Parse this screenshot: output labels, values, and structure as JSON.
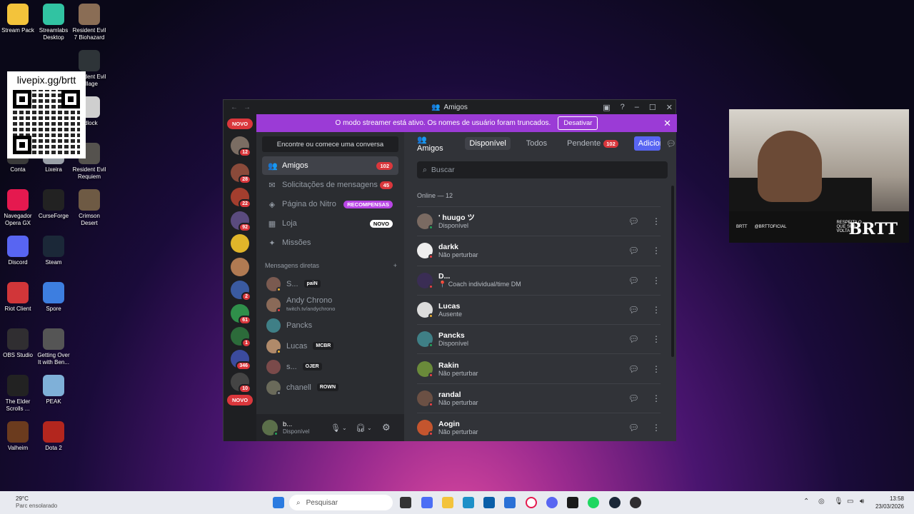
{
  "desktop": {
    "icons": [
      {
        "label": "Stream Pack",
        "glyph": "folder-icon",
        "color": "#f3c33b"
      },
      {
        "label": "Streamlabs Desktop",
        "glyph": "streamlabs-icon",
        "color": "#31c3a2"
      },
      {
        "label": "Resident Evil 7 Biohazard",
        "glyph": "game-icon",
        "color": "#8a6d55"
      },
      {
        "label": "Resident Evil Village",
        "glyph": "game-icon",
        "color": "#2e3438"
      },
      {
        "label": "adlock",
        "glyph": "game-icon",
        "color": "#cfcfcf"
      },
      {
        "label": "Conta",
        "glyph": "user-icon",
        "color": "#3a3a3a"
      },
      {
        "label": "Lixeira",
        "glyph": "trash-icon",
        "color": "#9aa0a8"
      },
      {
        "label": "Resident Evil Requiem",
        "glyph": "game-icon",
        "color": "#55524e"
      },
      {
        "label": "Navegador Opera GX",
        "glyph": "opera-icon",
        "color": "#e5194f"
      },
      {
        "label": "CurseForge",
        "glyph": "curseforge-icon",
        "color": "#222"
      },
      {
        "label": "Crimson Desert",
        "glyph": "game-icon",
        "color": "#6e5a44"
      },
      {
        "label": "Discord",
        "glyph": "discord-icon",
        "color": "#5865f2"
      },
      {
        "label": "Steam",
        "glyph": "steam-icon",
        "color": "#1b2838"
      },
      {
        "label": "Riot Client",
        "glyph": "riot-icon",
        "color": "#d13639"
      },
      {
        "label": "Spore",
        "glyph": "spore-icon",
        "color": "#3d7ee0"
      },
      {
        "label": "OBS Studio",
        "glyph": "obs-icon",
        "color": "#302e31"
      },
      {
        "label": "Getting Over It with Ben...",
        "glyph": "hammer-icon",
        "color": "#555"
      },
      {
        "label": "The Elder Scrolls ...",
        "glyph": "dragon-icon",
        "color": "#222"
      },
      {
        "label": "PEAK",
        "glyph": "mountain-icon",
        "color": "#7fb0d8"
      },
      {
        "label": "Valheim",
        "glyph": "valheim-icon",
        "color": "#6b3b1e"
      },
      {
        "label": "Dota 2",
        "glyph": "dota-icon",
        "color": "#b3261e"
      }
    ],
    "qr_text": "livepix.gg/brtt"
  },
  "window": {
    "title": "Amigos",
    "banner": {
      "text": "O modo streamer está ativo. Os nomes de usuário foram truncados.",
      "button": "Desativar"
    },
    "servers": {
      "top_badge": "NOVO",
      "bottom_badge": "NOVO",
      "items": [
        {
          "badge": "12",
          "color": "#7b6d63"
        },
        {
          "badge": "28",
          "color": "#8a4a3a"
        },
        {
          "badge": "22",
          "color": "#a33e2e"
        },
        {
          "badge": "92",
          "color": "#5a4b7e"
        },
        {
          "badge": "",
          "color": "#e0b52a"
        },
        {
          "badge": "",
          "color": "#b07a52"
        },
        {
          "badge": "2",
          "color": "#3a5aa0"
        },
        {
          "badge": "61",
          "color": "#2f8f4a"
        },
        {
          "badge": "1",
          "color": "#2c6b3a"
        },
        {
          "badge": "346",
          "color": "#3b4b9e"
        },
        {
          "badge": "10",
          "color": "#444"
        }
      ]
    },
    "sidebar": {
      "search": "Encontre ou comece uma conversa",
      "nav": [
        {
          "label": "Amigos",
          "pill": "102",
          "pill_style": "red",
          "icon": "friends-icon"
        },
        {
          "label": "Solicitações de mensagens",
          "pill": "45",
          "pill_style": "red",
          "icon": "mail-icon"
        },
        {
          "label": "Página do Nitro",
          "pill": "RECOMPENSAS",
          "pill_style": "purple",
          "icon": "nitro-icon"
        },
        {
          "label": "Loja",
          "pill": "NOVO",
          "pill_style": "white",
          "icon": "shop-icon"
        },
        {
          "label": "Missões",
          "pill": "",
          "pill_style": "",
          "icon": "quests-icon"
        }
      ],
      "dm_header": "Mensagens diretas",
      "dms": [
        {
          "name": "S...",
          "sub": "",
          "tag": "paiN",
          "status": "#f0b232"
        },
        {
          "name": "Andy Chrono",
          "sub": "twitch.tv/andychrono",
          "tag": "",
          "status": "#f23f43"
        },
        {
          "name": "Pancks",
          "sub": "",
          "tag": "",
          "status": ""
        },
        {
          "name": "Lucas",
          "sub": "",
          "tag": "MCBR",
          "status": "#f0b232"
        },
        {
          "name": "s...",
          "sub": "",
          "tag": "OJER",
          "status": ""
        },
        {
          "name": "chanell",
          "sub": "",
          "tag": "ROWN",
          "status": "#80848e"
        }
      ],
      "user": {
        "name": "b...",
        "status": "Disponível"
      }
    },
    "tabs": {
      "title": "Amigos",
      "items": [
        "Disponível",
        "Todos",
        "Pendente"
      ],
      "pending_count": "102",
      "add": "Adicionar amigo"
    },
    "search_placeholder": "Buscar",
    "online_header": "Online — 12",
    "friends": [
      {
        "name": "' huugo ツ",
        "status": "Disponível",
        "dot": "#23a55a",
        "color": "#7a6a62"
      },
      {
        "name": "darkk",
        "status": "Não perturbar",
        "dot": "#f23f43",
        "color": "#eeeeee"
      },
      {
        "name": "D...",
        "status": "📍 Coach individual/time DM",
        "dot": "#f23f43",
        "color": "#3a2d54"
      },
      {
        "name": "Lucas",
        "status": "Ausente",
        "dot": "#f0b232",
        "color": "#dcdcdc"
      },
      {
        "name": "Pancks",
        "status": "Disponível",
        "dot": "#23a55a",
        "color": "#3f7f86"
      },
      {
        "name": "Rakin",
        "status": "Não perturbar",
        "dot": "#f23f43",
        "color": "#6a8a3a"
      },
      {
        "name": "randal",
        "status": "Não perturbar",
        "dot": "#f23f43",
        "color": "#6b5044"
      },
      {
        "name": "Aogin",
        "status": "Não perturbar",
        "dot": "#f23f43",
        "color": "#c4552e"
      }
    ]
  },
  "webcam": {
    "overlay_items": [
      "BRTT",
      "@BRTTOFICIAL",
      "RESPEITA O QUE SUA VOLTA"
    ],
    "logo": "BRTT"
  },
  "taskbar": {
    "weather_temp": "29°C",
    "weather_desc": "Parc ensolarado",
    "search": "Pesquisar",
    "time": "13:58",
    "date": "23/03/2026"
  }
}
